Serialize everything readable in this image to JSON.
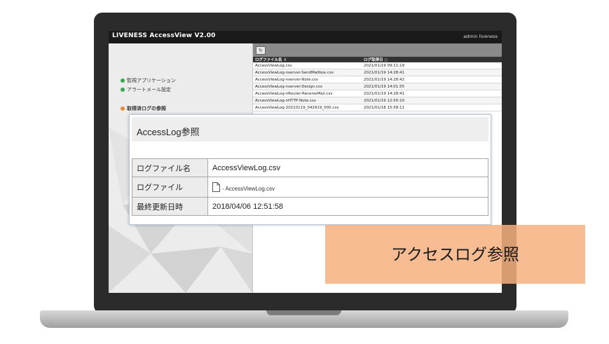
{
  "app": {
    "title": "LIVENESS AccessView V2.00",
    "user": "admin liveness"
  },
  "sidebar": {
    "items": [
      {
        "label": "監視アプリケーション",
        "icon": "green-check-bullet-icon"
      },
      {
        "label": "アラートメール設定",
        "icon": "green-check-bullet-icon"
      },
      {
        "label": "取得済ログの参照",
        "icon": "orange-bullet-icon"
      }
    ]
  },
  "toolbar": {
    "icon": "refresh-icon"
  },
  "log_table": {
    "headers": [
      "ログファイル名 ⇩",
      "ログ取得日 ○"
    ],
    "rows": [
      [
        "AccessViewLog.csv",
        "2021/01/19 09:11:19"
      ],
      [
        "AccessViewLog-nserver-SendMailbox.csv",
        "2021/01/19 14:28:41"
      ],
      [
        "AccessViewLog-nserver-Note.csv",
        "2021/01/19 14:28:42"
      ],
      [
        "AccessViewLog-nserver-Design.csv",
        "2021/01/19 14:01:55"
      ],
      [
        "AccessViewLog-nRouter-ReceiveMail.csv",
        "2021/01/19 14:28:41"
      ],
      [
        "AccessViewLog-nHTTP-Note.csv",
        "2021/01/19 12:50:10"
      ],
      [
        "AccessViewLog-20210119_042919_000.csv",
        "2021/01/18 15:58:11"
      ]
    ]
  },
  "dialog": {
    "title": "AccessLog参照",
    "rows": [
      {
        "label": "ログファイル名",
        "value": "AccessViewLog.csv"
      },
      {
        "label": "ログファイル",
        "value": "- AccessViewLog.csv"
      },
      {
        "label": "最終更新日時",
        "value": "2018/04/06 12:51:58"
      }
    ]
  },
  "caption": {
    "text": "アクセスログ参照"
  },
  "colors": {
    "caption_bg": "#f6b07e",
    "header_bg": "#1a1a1a",
    "toolbar_bg": "#8a8a8a",
    "green": "#3aa655",
    "orange": "#e8893a"
  }
}
